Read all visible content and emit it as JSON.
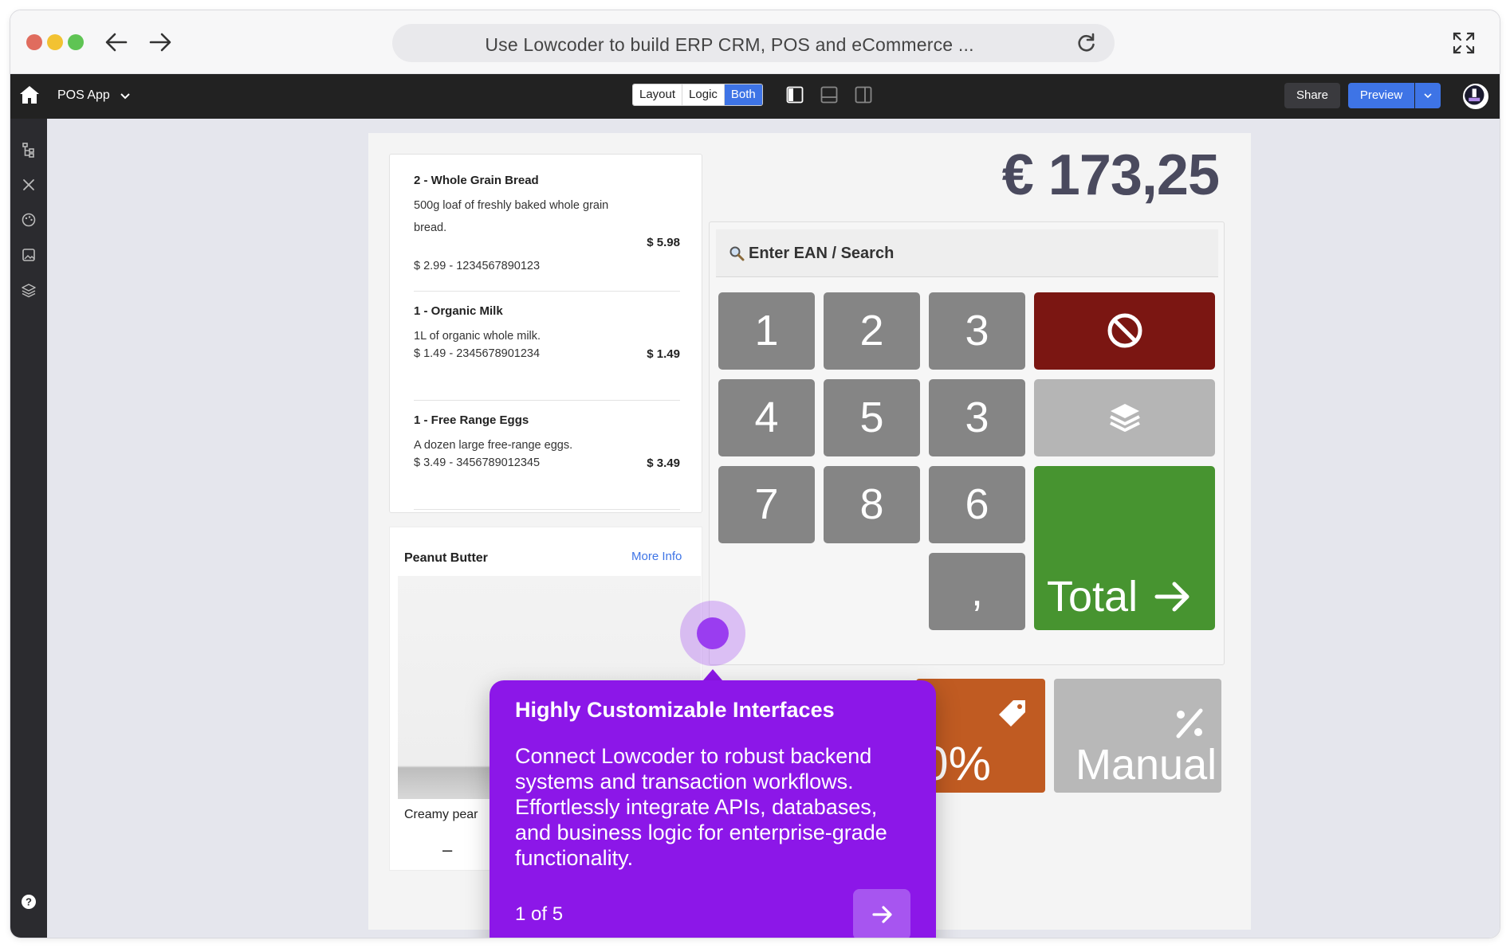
{
  "browser": {
    "url_title": "Use Lowcoder to build ERP CRM, POS and eCommerce ...",
    "traffic_lights": [
      "#e06c5e",
      "#f2c232",
      "#5fc454"
    ]
  },
  "app_bar": {
    "app_name": "POS App",
    "modes": [
      "Layout",
      "Logic",
      "Both"
    ],
    "active_mode": "Both",
    "share_label": "Share",
    "preview_label": "Preview"
  },
  "cart": {
    "items": [
      {
        "title": "2 - Whole Grain Bread",
        "desc": "500g loaf of freshly baked whole grain bread.",
        "meta": "$ 2.99 - 1234567890123",
        "price": "$ 5.98"
      },
      {
        "title": "1 - Organic Milk",
        "desc": "1L of organic whole milk.",
        "meta": "$ 1.49 - 2345678901234",
        "price": "$ 1.49"
      },
      {
        "title": "1 - Free Range Eggs",
        "desc": "A dozen large free-range eggs.",
        "meta": "$ 3.49 - 3456789012345",
        "price": "$ 3.49"
      }
    ]
  },
  "product": {
    "name": "Peanut Butter",
    "more_info": "More Info",
    "desc": "Creamy pear",
    "minus": "–",
    "plus": "_"
  },
  "pos": {
    "total_amount": "€ 173,25",
    "search_placeholder": "Enter EAN / Search",
    "keys": [
      "1",
      "2",
      "3",
      "4",
      "5",
      "3",
      "7",
      "8",
      "6",
      ","
    ],
    "total_label": "Total",
    "discount_label": "0%",
    "manual_label": "Manual",
    "colors": {
      "cancel": "#7b1612",
      "total": "#479430",
      "discount": "#c05b22",
      "key": "#858585"
    }
  },
  "tour": {
    "title": "Highly Customizable Interfaces",
    "body": "Connect Lowcoder to robust backend systems and transaction workflows. Effortlessly integrate APIs, databases, and business logic for enterprise-grade functionality.",
    "step": "1 of 5",
    "accent": "#8c17e8"
  }
}
